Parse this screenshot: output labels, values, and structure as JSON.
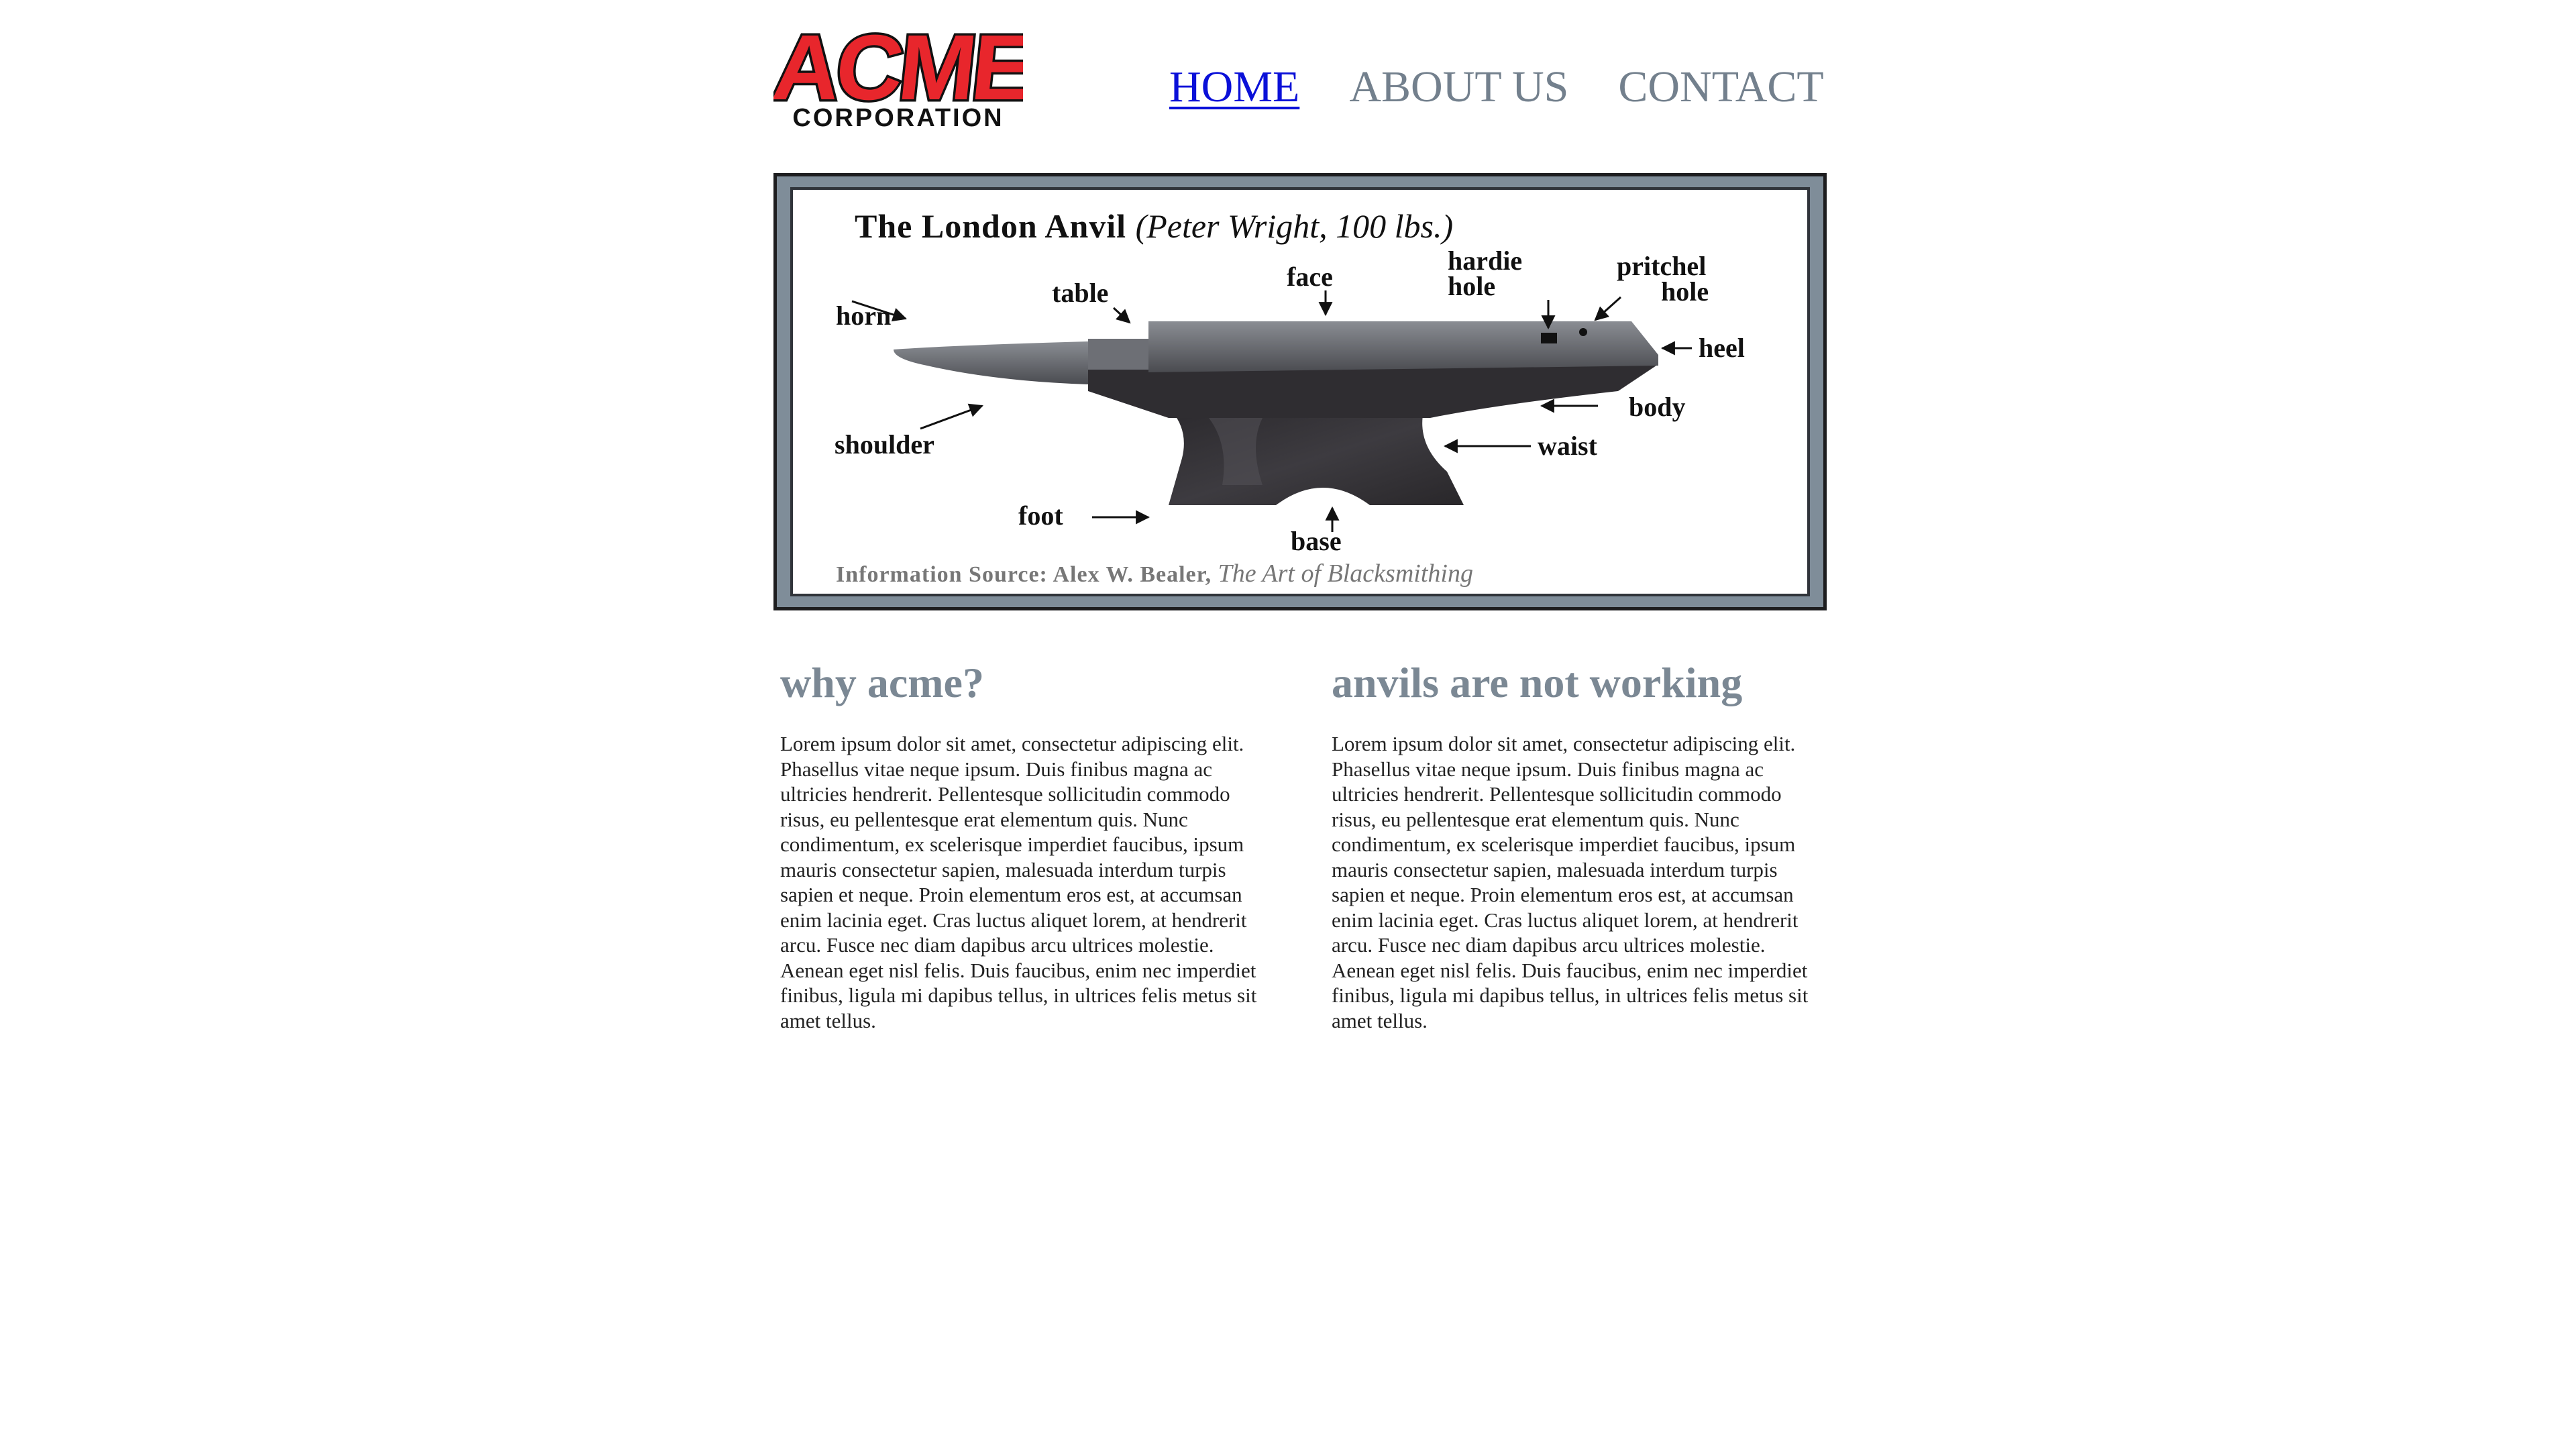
{
  "header": {
    "logo": {
      "word": "ACME",
      "subword": "CORPORATION",
      "color": "#e8262c"
    },
    "nav": [
      {
        "label": "HOME",
        "active": true
      },
      {
        "label": "ABOUT US",
        "active": false
      },
      {
        "label": "CONTACT",
        "active": false
      }
    ]
  },
  "hero": {
    "title": "The London Anvil",
    "subtitle": "(Peter Wright, 100 lbs.)",
    "labels": {
      "horn": "horn",
      "table": "table",
      "face": "face",
      "hardie_line1": "hardie",
      "hardie_line2": "hole",
      "pritchel_line1": "pritchel",
      "pritchel_line2": "hole",
      "heel": "heel",
      "body": "body",
      "shoulder": "shoulder",
      "waist": "waist",
      "foot": "foot",
      "base": "base"
    },
    "source_prefix": "Information Source: Alex W. Bealer,",
    "source_book": "The Art of Blacksmithing"
  },
  "columns": [
    {
      "heading": "why acme?",
      "body": "Lorem ipsum dolor sit amet, consectetur adipiscing elit. Phasellus vitae neque ipsum. Duis finibus magna ac ultricies hendrerit. Pellentesque sollicitudin commodo risus, eu pellentesque erat elementum quis. Nunc condimentum, ex scelerisque imperdiet faucibus, ipsum mauris consectetur sapien, malesuada interdum turpis sapien et neque. Proin elementum eros est, at accumsan enim lacinia eget. Cras luctus aliquet lorem, at hendrerit arcu. Fusce nec diam dapibus arcu ultrices molestie. Aenean eget nisl felis. Duis faucibus, enim nec imperdiet finibus, ligula mi dapibus tellus, in ultrices felis metus sit amet tellus."
    },
    {
      "heading": "anvils are not working",
      "body": "Lorem ipsum dolor sit amet, consectetur adipiscing elit. Phasellus vitae neque ipsum. Duis finibus magna ac ultricies hendrerit. Pellentesque sollicitudin commodo risus, eu pellentesque erat elementum quis. Nunc condimentum, ex scelerisque imperdiet faucibus, ipsum mauris consectetur sapien, malesuada interdum turpis sapien et neque. Proin elementum eros est, at accumsan enim lacinia eget. Cras luctus aliquet lorem, at hendrerit arcu. Fusce nec diam dapibus arcu ultrices molestie. Aenean eget nisl felis. Duis faucibus, enim nec imperdiet finibus, ligula mi dapibus tellus, in ultrices felis metus sit amet tellus."
    }
  ]
}
